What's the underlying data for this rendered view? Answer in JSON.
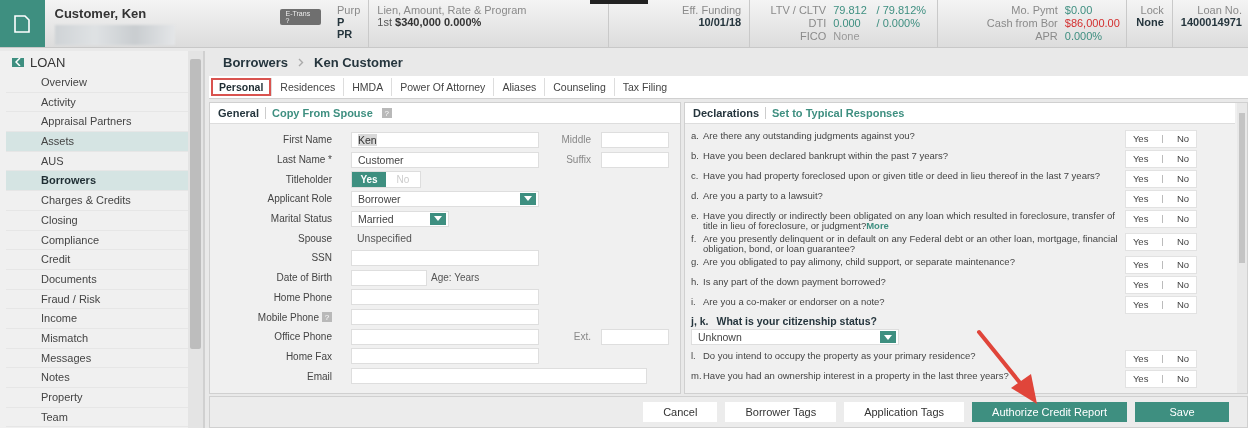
{
  "header": {
    "borrower_name": "Customer, Ken",
    "badge": "E-Trans ?",
    "purpose": {
      "label": "Purp",
      "lines": [
        "P",
        "PR"
      ]
    },
    "lien": {
      "label": "Lien, Amount, Rate & Program",
      "position": "1st",
      "amount": "$340,000",
      "rate": "0.000%"
    },
    "funding": {
      "label": "Eff. Funding",
      "value": "10/01/18"
    },
    "ratios": [
      {
        "label": "LTV / CLTV",
        "value": "79.812",
        "value2": "/ 79.812%",
        "muted": false
      },
      {
        "label": "DTI",
        "value": "0.000",
        "value2": "/ 0.000%",
        "muted": false
      },
      {
        "label": "FICO",
        "value": "None",
        "muted": true
      }
    ],
    "payments": [
      {
        "label": "Mo. Pymt",
        "value": "$0.00",
        "alert": false
      },
      {
        "label": "Cash from Bor",
        "value": "$86,000.00",
        "alert": true
      },
      {
        "label": "APR",
        "value": "0.000%",
        "alert": false
      }
    ],
    "lock": {
      "label": "Lock",
      "value": "None"
    },
    "loan_no": {
      "label": "Loan No.",
      "value": "1400014971"
    }
  },
  "sidebar": {
    "title": "LOAN",
    "items": [
      {
        "label": "Overview",
        "selected": false,
        "hovered": false
      },
      {
        "label": "Activity",
        "selected": false,
        "hovered": false
      },
      {
        "label": "Appraisal Partners",
        "selected": false,
        "hovered": false
      },
      {
        "label": "Assets",
        "selected": false,
        "hovered": true
      },
      {
        "label": "AUS",
        "selected": false,
        "hovered": false
      },
      {
        "label": "Borrowers",
        "selected": true,
        "hovered": false
      },
      {
        "label": "Charges & Credits",
        "selected": false,
        "hovered": false
      },
      {
        "label": "Closing",
        "selected": false,
        "hovered": false
      },
      {
        "label": "Compliance",
        "selected": false,
        "hovered": false
      },
      {
        "label": "Credit",
        "selected": false,
        "hovered": false
      },
      {
        "label": "Documents",
        "selected": false,
        "hovered": false
      },
      {
        "label": "Fraud / Risk",
        "selected": false,
        "hovered": false
      },
      {
        "label": "Income",
        "selected": false,
        "hovered": false
      },
      {
        "label": "Mismatch",
        "selected": false,
        "hovered": false
      },
      {
        "label": "Messages",
        "selected": false,
        "hovered": false
      },
      {
        "label": "Notes",
        "selected": false,
        "hovered": false
      },
      {
        "label": "Property",
        "selected": false,
        "hovered": false
      },
      {
        "label": "Team",
        "selected": false,
        "hovered": false
      }
    ]
  },
  "breadcrumb": [
    "Borrowers",
    "Ken Customer"
  ],
  "tabs": [
    {
      "label": "Personal",
      "selected": true
    },
    {
      "label": "Residences",
      "selected": false
    },
    {
      "label": "HMDA",
      "selected": false
    },
    {
      "label": "Power Of Attorney",
      "selected": false
    },
    {
      "label": "Aliases",
      "selected": false
    },
    {
      "label": "Counseling",
      "selected": false
    },
    {
      "label": "Tax Filing",
      "selected": false
    }
  ],
  "general": {
    "title": "General",
    "link": "Copy From Spouse",
    "help": "?",
    "fields": [
      {
        "kind": "text",
        "label": "First Name",
        "value": "Ken",
        "side_label": "Middle"
      },
      {
        "kind": "text",
        "label": "Last Name *",
        "value": "Customer",
        "side_label": "Suffix"
      },
      {
        "kind": "toggle",
        "label": "Titleholder",
        "options": [
          {
            "label": "Yes",
            "selected": true
          },
          {
            "label": "No",
            "selected": false
          }
        ]
      },
      {
        "kind": "select",
        "label": "Applicant Role",
        "value": "Borrower",
        "wide": true
      },
      {
        "kind": "select",
        "label": "Marital Status",
        "value": "Married",
        "wide": false
      },
      {
        "kind": "static",
        "label": "Spouse",
        "value": "Unspecified"
      },
      {
        "kind": "text",
        "label": "SSN"
      },
      {
        "kind": "date",
        "label": "Date of Birth",
        "note": "Age: Years"
      },
      {
        "kind": "text",
        "label": "Home Phone"
      },
      {
        "kind": "text",
        "label": "Mobile Phone",
        "help": "?"
      },
      {
        "kind": "text",
        "label": "Office Phone",
        "side_label": "Ext."
      },
      {
        "kind": "text",
        "label": "Home Fax"
      },
      {
        "kind": "email",
        "label": "Email"
      }
    ]
  },
  "declarations": {
    "title": "Declarations",
    "link": "Set to Typical Responses",
    "items": [
      {
        "kind": "yesno",
        "letter": "a.",
        "text": "Are there any outstanding judgments against you?",
        "yes": "Yes",
        "no": "No"
      },
      {
        "kind": "yesno",
        "letter": "b.",
        "text": "Have you been declared bankrupt within the past 7 years?",
        "yes": "Yes",
        "no": "No"
      },
      {
        "kind": "yesno",
        "letter": "c.",
        "text": "Have you had property foreclosed upon or given title or deed in lieu thereof in the last 7 years?",
        "yes": "Yes",
        "no": "No"
      },
      {
        "kind": "yesno",
        "letter": "d.",
        "text": "Are you a party to a lawsuit?",
        "yes": "Yes",
        "no": "No"
      },
      {
        "kind": "yesno",
        "letter": "e.",
        "text": "Have you directly or indirectly been obligated on any loan which resulted in foreclosure, transfer of title in lieu of foreclosure, or judgment?",
        "more": "More",
        "yes": "Yes",
        "no": "No"
      },
      {
        "kind": "yesno",
        "letter": "f.",
        "text": "Are you presently delinquent or in default on any Federal debt or an other loan, mortgage, financial obligation, bond, or loan guarantee?",
        "yes": "Yes",
        "no": "No"
      },
      {
        "kind": "yesno",
        "letter": "g.",
        "text": "Are you obligated to pay alimony, child support, or separate maintenance?",
        "yes": "Yes",
        "no": "No"
      },
      {
        "kind": "yesno",
        "letter": "h.",
        "text": "Is any part of the down payment borrowed?",
        "yes": "Yes",
        "no": "No"
      },
      {
        "kind": "yesno",
        "letter": "i.",
        "text": "Are you a co-maker or endorser on a note?",
        "yes": "Yes",
        "no": "No"
      },
      {
        "kind": "select",
        "letter": "j, k.",
        "text": "What is your citizenship status?",
        "value": "Unknown"
      },
      {
        "kind": "yesno",
        "letter": "l.",
        "text": "Do you intend to occupy the property as your primary residence?",
        "yes": "Yes",
        "no": "No"
      },
      {
        "kind": "yesno",
        "letter": "m.",
        "text": "Have you had an ownership interest in a property in the last three years?",
        "yes": "Yes",
        "no": "No"
      }
    ]
  },
  "footer_buttons": [
    {
      "label": "Cancel",
      "kind": "plain"
    },
    {
      "label": "Borrower Tags",
      "kind": "plain"
    },
    {
      "label": "Application Tags",
      "kind": "plain"
    },
    {
      "label": "Authorize Credit Report",
      "kind": "primary"
    },
    {
      "label": "Save",
      "kind": "primary"
    }
  ]
}
